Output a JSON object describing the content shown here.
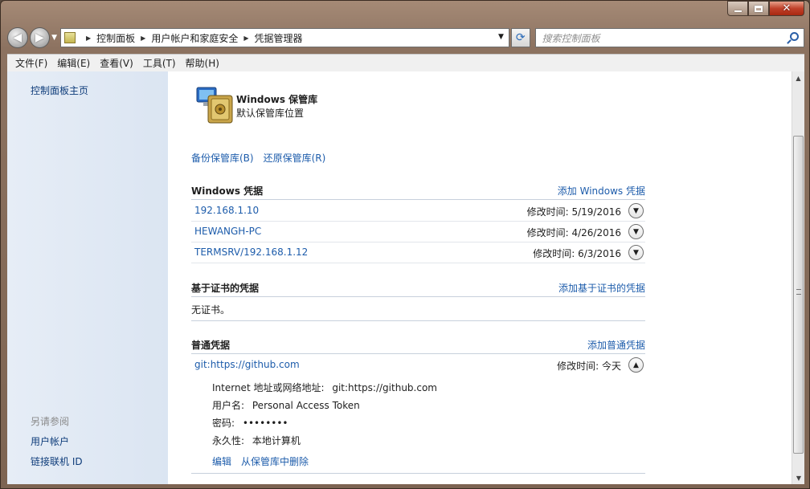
{
  "address": {
    "crumbs": [
      "控制面板",
      "用户帐户和家庭安全",
      "凭据管理器"
    ]
  },
  "search": {
    "placeholder": "搜索控制面板"
  },
  "menu": [
    "文件(F)",
    "编辑(E)",
    "查看(V)",
    "工具(T)",
    "帮助(H)"
  ],
  "sidebar": {
    "home": "控制面板主页",
    "see_also": "另请参阅",
    "links": [
      "用户帐户",
      "链接联机 ID"
    ]
  },
  "vault": {
    "title": "Windows 保管库",
    "subtitle": "默认保管库位置",
    "backup": "备份保管库(B)",
    "restore": "还原保管库(R)"
  },
  "windows_creds": {
    "title": "Windows 凭据",
    "add": "添加 Windows 凭据",
    "items": [
      {
        "name": "192.168.1.10",
        "time": "修改时间:  5/19/2016"
      },
      {
        "name": "HEWANGH-PC",
        "time": "修改时间:  4/26/2016"
      },
      {
        "name": "TERMSRV/192.168.1.12",
        "time": "修改时间:  6/3/2016"
      }
    ]
  },
  "cert_creds": {
    "title": "基于证书的凭据",
    "add": "添加基于证书的凭据",
    "empty": "无证书。"
  },
  "generic_creds": {
    "title": "普通凭据",
    "add": "添加普通凭据",
    "item": {
      "name": "git:https://github.com",
      "time": "修改时间:  今天",
      "address_label": "Internet 地址或网络地址:",
      "address_value": "git:https://github.com",
      "user_label": "用户名:",
      "user_value": "Personal Access Token",
      "password_label": "密码:",
      "password_value": "••••••••",
      "persistence_label": "永久性:",
      "persistence_value": "本地计算机",
      "edit": "编辑",
      "remove": "从保管库中删除"
    }
  }
}
